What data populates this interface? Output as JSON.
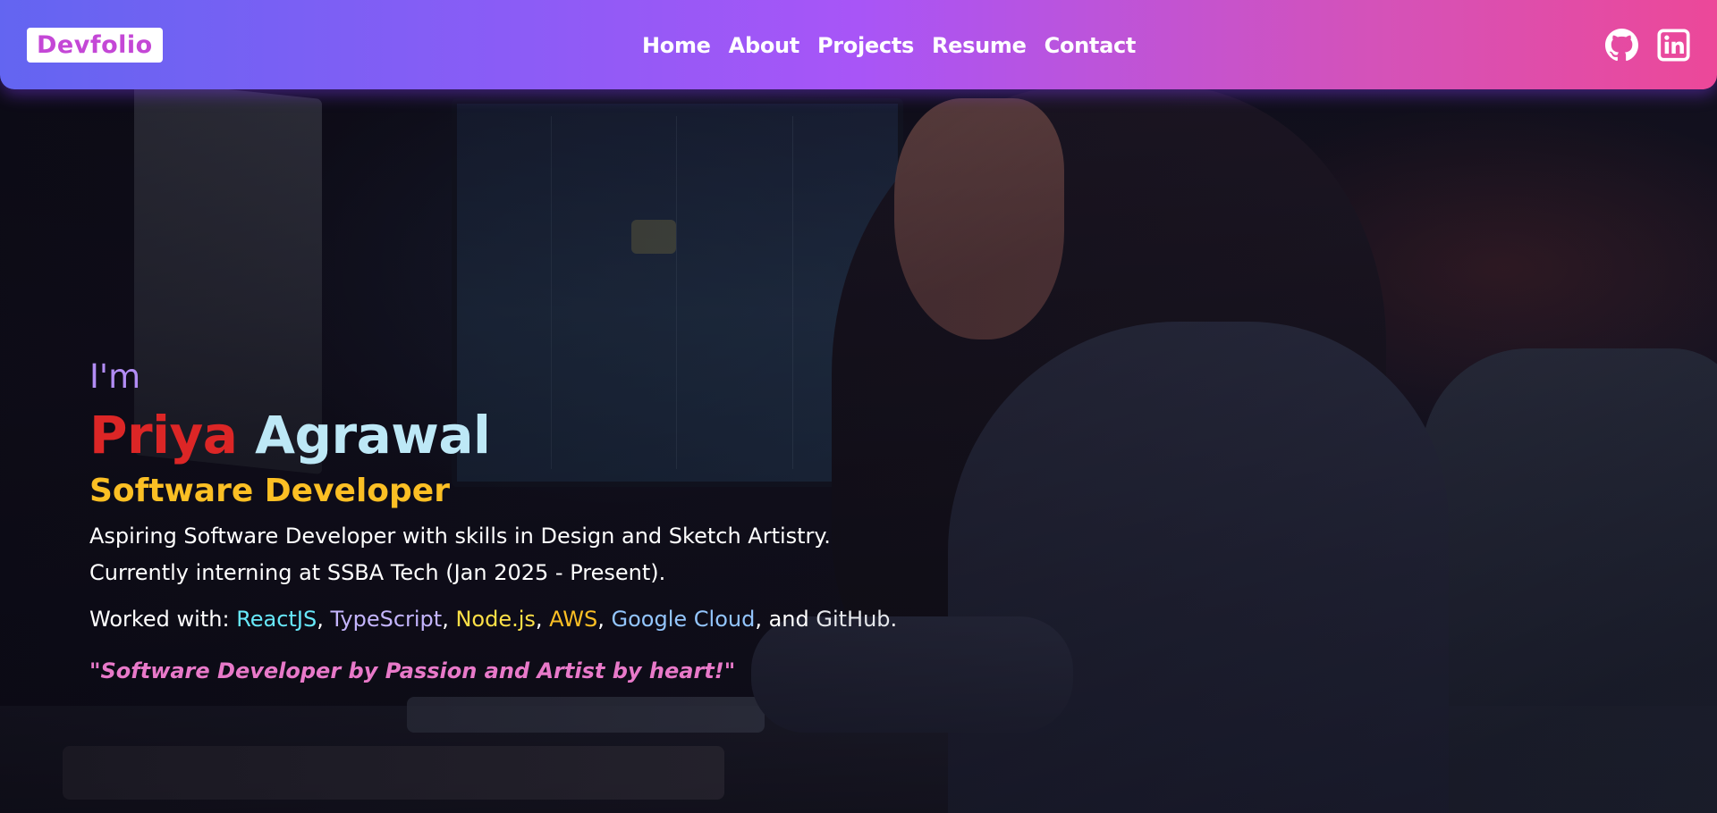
{
  "navbar": {
    "logo": "Devfolio",
    "links": [
      "Home",
      "About",
      "Projects",
      "Resume",
      "Contact"
    ],
    "social": [
      {
        "icon": "github-icon",
        "label": "GitHub"
      },
      {
        "icon": "linkedin-icon",
        "label": "LinkedIn"
      }
    ]
  },
  "intro": {
    "greeting": "I'm",
    "first_name": "Priya",
    "last_name": "Agrawal",
    "role": "Software Developer",
    "bio_line1": "Aspiring Software Developer with skills in Design and Sketch Artistry.",
    "bio_line2": "Currently interning at SSBA Tech (Jan 2025 - Present).",
    "worked_with_label": "Worked with: ",
    "technologies": [
      "ReactJS",
      "TypeScript",
      "Node.js",
      "AWS",
      "Google Cloud",
      "GitHub"
    ],
    "separator": ", ",
    "final_conjunction": ", and ",
    "end_punct": ".",
    "quote": "\"Software Developer by Passion and Artist by heart!\""
  },
  "colors": {
    "nav_gradient_start": "#6365f1",
    "nav_gradient_end": "#ec4899",
    "logo_text": "#c447d6",
    "greeting": "#b28cf5",
    "first_name": "#dc2626",
    "last_name": "#bde8f6",
    "role": "#fbbf24",
    "quote": "#e879c9"
  }
}
